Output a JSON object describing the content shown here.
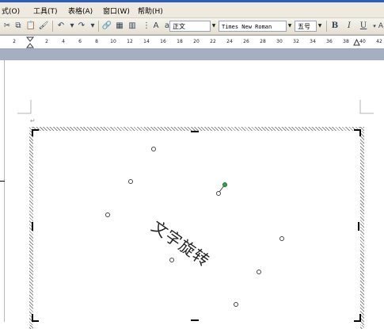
{
  "menubar": {
    "items": [
      "式(O)",
      "工具(T)",
      "表格(A)",
      "窗口(W)",
      "帮助(H)"
    ]
  },
  "toolbar": {
    "style_value": "正文",
    "font_value": "Times New Roman",
    "size_value": "五号",
    "bold_label": "B",
    "italic_label": "I",
    "underline_label": "U",
    "zoom_small": "A"
  },
  "ruler": {
    "left_marker": "2",
    "ticks": [
      "2",
      "4",
      "6",
      "8",
      "10",
      "12",
      "14",
      "16",
      "18",
      "20",
      "22",
      "24",
      "26",
      "28",
      "30",
      "32",
      "34",
      "36",
      "38",
      "40",
      "42"
    ]
  },
  "document": {
    "rotated_text": "文字旋转",
    "rotation_degrees": 35
  },
  "colors": {
    "rotation_handle": "#3aa14a",
    "menubar_bg": "#eeeae0",
    "ruler_strip": "#a4afc1"
  }
}
